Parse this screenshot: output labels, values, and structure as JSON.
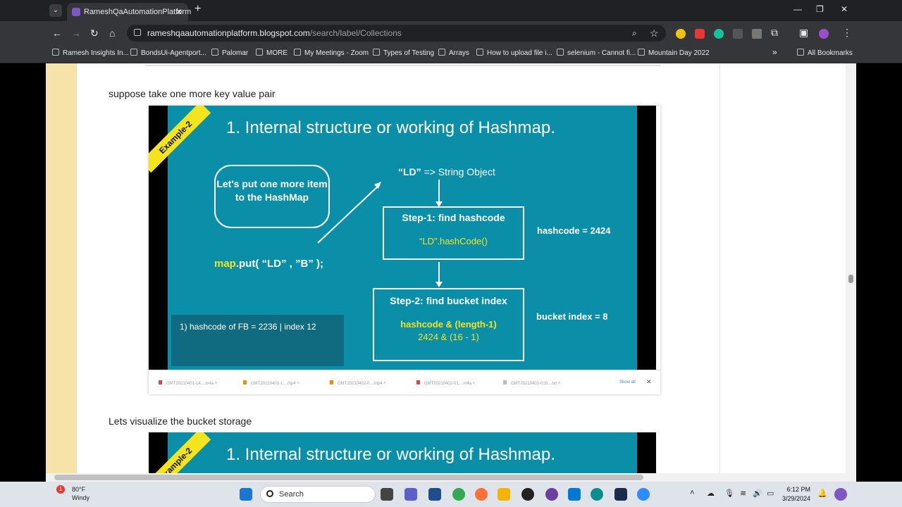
{
  "browser": {
    "tab_title": "RameshQaAutomationPlatform",
    "url_host": "rameshqaautomationplatform.blogspot.com",
    "url_path": "/search/label/Collections",
    "bookmarks": [
      "Ramesh Insights In...",
      "BondsUi-Agentport...",
      "Palomar",
      "MORE",
      "My Meetings - Zoom",
      "Types of Testing",
      "Arrays",
      "How to upload file i...",
      "selenium - Cannot fi...",
      "Mountain Day 2022"
    ],
    "all_bookmarks": "All Bookmarks",
    "more": "»"
  },
  "post": {
    "line1": "suppose take one more key value pair",
    "line2": "Lets visualize the bucket storage"
  },
  "slide": {
    "ribbon": "Example-2",
    "title": "1.  Internal structure or working of Hashmap.",
    "callout": "Let's put one more item to the HashMap",
    "code_kw": "map",
    "code_rest": ".put( “LD” , ”B” );",
    "ld_label": "“LD”",
    "ld_rest": "=> String Object",
    "step1_title": "Step-1: find hashcode",
    "step1_body": "“LD”.hashCode()",
    "hashcode": "hashcode = 2424",
    "step2_title": "Step-2: find bucket index",
    "step2_line1": "hashcode & (length-1)",
    "step2_line2": "2424 & (16 - 1)",
    "bucket": "bucket index = 8",
    "panel": "1)     hashcode of FB = 2236  | index 12"
  },
  "downloads": {
    "items": [
      "GMT20210401-14....m4a",
      "GMT20210401-1....mp4",
      "GMT20210402-0....mp4",
      "GMT20210402-01....m4a",
      "GMT20210402-010....txt"
    ],
    "show_all": "Show all"
  },
  "taskbar": {
    "temp": "80°F",
    "condition": "Windy",
    "search": "Search",
    "time": "6:12 PM",
    "date": "3/29/2024",
    "badge": "1"
  }
}
